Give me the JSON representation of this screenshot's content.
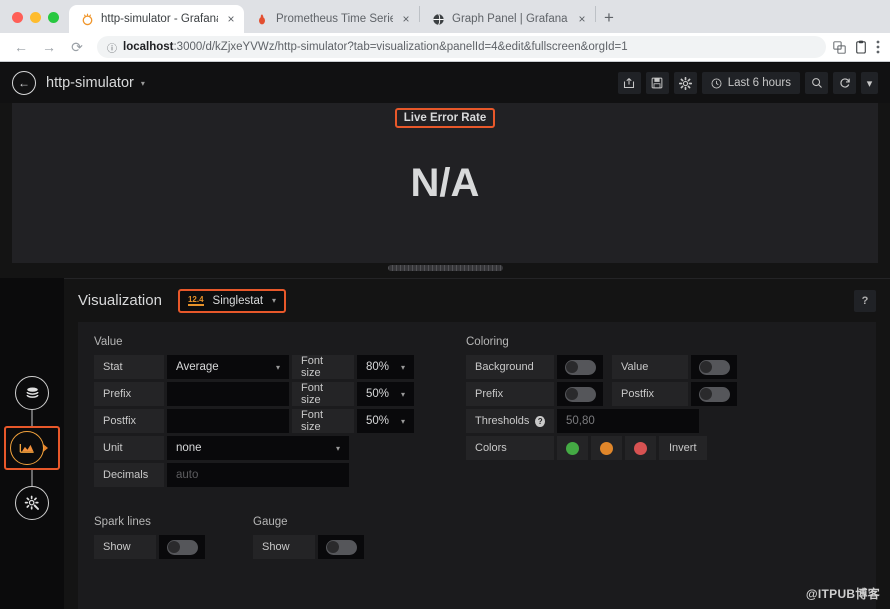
{
  "browser": {
    "tabs": [
      {
        "title": "http-simulator - Grafana",
        "favicon": "grafana-icon",
        "active": true,
        "close_label": "×"
      },
      {
        "title": "Prometheus Time Series Collec",
        "favicon": "prometheus-icon",
        "active": false,
        "close_label": "×"
      },
      {
        "title": "Graph Panel | Grafana Docume",
        "favicon": "globe-icon",
        "active": false,
        "close_label": "×"
      }
    ],
    "new_tab_label": "+",
    "nav": {
      "back": "←",
      "forward": "→",
      "reload": "⟳"
    },
    "omnibox": {
      "info_icon": "ⓘ",
      "url_host": "localhost",
      "url_path": ":3000/d/kZjxeYVWz/http-simulator?tab=visualization&panelId=4&edit&fullscreen&orgId=1"
    },
    "omni_icons": [
      "translate-icon",
      "profile-icon",
      "menu-icon"
    ]
  },
  "grafana": {
    "topnav": {
      "back_icon": "←",
      "dashboard_title": "http-simulator",
      "caret": "▾",
      "buttons": [
        {
          "name": "share-dashboard-button",
          "glyph": "⤴"
        },
        {
          "name": "save-dashboard-button",
          "glyph": "Ὃe"
        },
        {
          "name": "dashboard-settings-button",
          "glyph": "⚙"
        }
      ],
      "time_picker": {
        "icon": "◴",
        "label": "Last 6 hours"
      },
      "zoom_out_label": "⌕",
      "refresh_label": "⟳",
      "refresh_caret": "▾"
    },
    "panel": {
      "title": "Live Error Rate",
      "value": "N/A"
    },
    "editor": {
      "header_title": "Visualization",
      "viz_type": {
        "icon_label": "12.4",
        "name": "Singlestat",
        "caret": "▾"
      },
      "help_label": "?",
      "value_section": {
        "title": "Value",
        "rows": [
          {
            "label": "Stat",
            "value": "Average",
            "fontsize_label": "Font size",
            "fontsize_value": "80%"
          },
          {
            "label": "Prefix",
            "value": "",
            "fontsize_label": "Font size",
            "fontsize_value": "50%"
          },
          {
            "label": "Postfix",
            "value": "",
            "fontsize_label": "Font size",
            "fontsize_value": "50%"
          }
        ],
        "unit_label": "Unit",
        "unit_value": "none",
        "decimals_label": "Decimals",
        "decimals_placeholder": "auto"
      },
      "coloring_section": {
        "title": "Coloring",
        "toggles": [
          {
            "label": "Background",
            "on": false
          },
          {
            "label": "Value",
            "on": false
          },
          {
            "label": "Prefix",
            "on": false
          },
          {
            "label": "Postfix",
            "on": false
          }
        ],
        "thresholds_label": "Thresholds",
        "thresholds_help": "?",
        "thresholds_value": "50,80",
        "colors_label": "Colors",
        "colors": [
          "#44aa44",
          "#e0862a",
          "#d75252"
        ],
        "invert_label": "Invert"
      },
      "sparklines_section": {
        "title": "Spark lines",
        "show_label": "Show",
        "on": false
      },
      "gauge_section": {
        "title": "Gauge",
        "show_label": "Show",
        "on": false
      }
    },
    "sidebar": {
      "items": [
        {
          "name": "queries-datasource-icon",
          "glyph": "⌸",
          "active": false
        },
        {
          "name": "visualization-icon",
          "glyph": "◢",
          "active": true
        },
        {
          "name": "general-settings-icon",
          "glyph": "⚙",
          "active": false
        }
      ]
    }
  },
  "watermark": "@ITPUB博客"
}
